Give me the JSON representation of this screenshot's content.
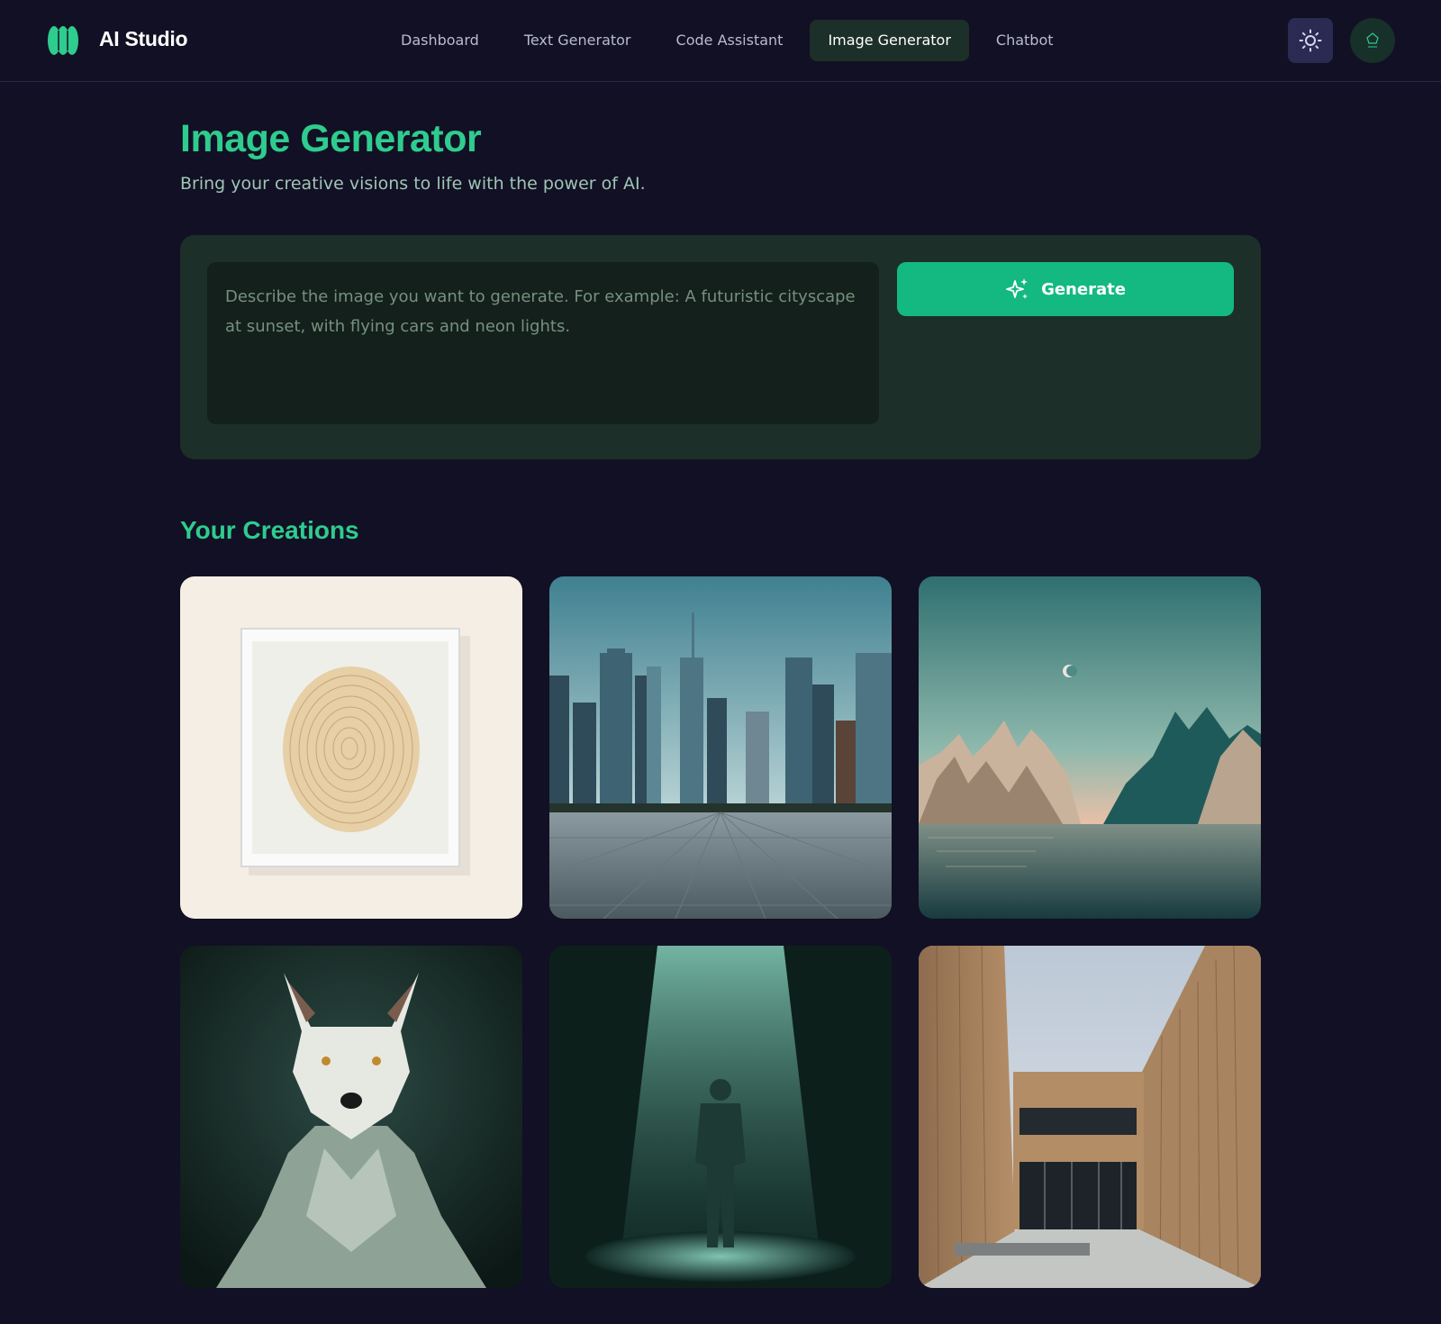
{
  "app": {
    "name": "AI Studio",
    "accent_color": "#13b981",
    "background_color": "#121024"
  },
  "nav": {
    "items": [
      {
        "label": "Dashboard",
        "active": false
      },
      {
        "label": "Text Generator",
        "active": false
      },
      {
        "label": "Code Assistant",
        "active": false
      },
      {
        "label": "Image Generator",
        "active": true
      },
      {
        "label": "Chatbot",
        "active": false
      }
    ],
    "theme_toggle_icon": "sun-icon",
    "avatar_icon": "user-avatar-icon"
  },
  "page": {
    "title": "Image Generator",
    "subtitle": "Bring your creative visions to life with the power of AI."
  },
  "generator": {
    "prompt_placeholder": "Describe the image you want to generate. For example: A futuristic cityscape at sunset, with flying cars and neon lights.",
    "prompt_value": "",
    "generate_label": "Generate",
    "generate_icon": "sparkles-icon"
  },
  "creations": {
    "title": "Your Creations",
    "items": [
      {
        "subject": "framed-tree-ring-art"
      },
      {
        "subject": "city-skyline-plaza"
      },
      {
        "subject": "mountains-over-water-with-moon"
      },
      {
        "subject": "white-wolf-portrait"
      },
      {
        "subject": "figure-in-spotlight"
      },
      {
        "subject": "modern-building-courtyard"
      }
    ]
  }
}
